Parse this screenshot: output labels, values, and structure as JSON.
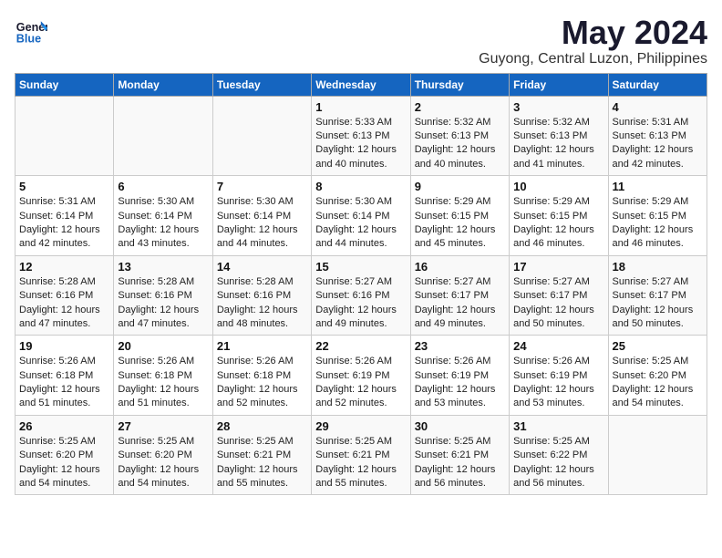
{
  "header": {
    "logo_line1": "General",
    "logo_line2": "Blue",
    "month": "May 2024",
    "location": "Guyong, Central Luzon, Philippines"
  },
  "weekdays": [
    "Sunday",
    "Monday",
    "Tuesday",
    "Wednesday",
    "Thursday",
    "Friday",
    "Saturday"
  ],
  "weeks": [
    [
      {
        "day": "",
        "info": ""
      },
      {
        "day": "",
        "info": ""
      },
      {
        "day": "",
        "info": ""
      },
      {
        "day": "1",
        "info": "Sunrise: 5:33 AM\nSunset: 6:13 PM\nDaylight: 12 hours\nand 40 minutes."
      },
      {
        "day": "2",
        "info": "Sunrise: 5:32 AM\nSunset: 6:13 PM\nDaylight: 12 hours\nand 40 minutes."
      },
      {
        "day": "3",
        "info": "Sunrise: 5:32 AM\nSunset: 6:13 PM\nDaylight: 12 hours\nand 41 minutes."
      },
      {
        "day": "4",
        "info": "Sunrise: 5:31 AM\nSunset: 6:13 PM\nDaylight: 12 hours\nand 42 minutes."
      }
    ],
    [
      {
        "day": "5",
        "info": "Sunrise: 5:31 AM\nSunset: 6:14 PM\nDaylight: 12 hours\nand 42 minutes."
      },
      {
        "day": "6",
        "info": "Sunrise: 5:30 AM\nSunset: 6:14 PM\nDaylight: 12 hours\nand 43 minutes."
      },
      {
        "day": "7",
        "info": "Sunrise: 5:30 AM\nSunset: 6:14 PM\nDaylight: 12 hours\nand 44 minutes."
      },
      {
        "day": "8",
        "info": "Sunrise: 5:30 AM\nSunset: 6:14 PM\nDaylight: 12 hours\nand 44 minutes."
      },
      {
        "day": "9",
        "info": "Sunrise: 5:29 AM\nSunset: 6:15 PM\nDaylight: 12 hours\nand 45 minutes."
      },
      {
        "day": "10",
        "info": "Sunrise: 5:29 AM\nSunset: 6:15 PM\nDaylight: 12 hours\nand 46 minutes."
      },
      {
        "day": "11",
        "info": "Sunrise: 5:29 AM\nSunset: 6:15 PM\nDaylight: 12 hours\nand 46 minutes."
      }
    ],
    [
      {
        "day": "12",
        "info": "Sunrise: 5:28 AM\nSunset: 6:16 PM\nDaylight: 12 hours\nand 47 minutes."
      },
      {
        "day": "13",
        "info": "Sunrise: 5:28 AM\nSunset: 6:16 PM\nDaylight: 12 hours\nand 47 minutes."
      },
      {
        "day": "14",
        "info": "Sunrise: 5:28 AM\nSunset: 6:16 PM\nDaylight: 12 hours\nand 48 minutes."
      },
      {
        "day": "15",
        "info": "Sunrise: 5:27 AM\nSunset: 6:16 PM\nDaylight: 12 hours\nand 49 minutes."
      },
      {
        "day": "16",
        "info": "Sunrise: 5:27 AM\nSunset: 6:17 PM\nDaylight: 12 hours\nand 49 minutes."
      },
      {
        "day": "17",
        "info": "Sunrise: 5:27 AM\nSunset: 6:17 PM\nDaylight: 12 hours\nand 50 minutes."
      },
      {
        "day": "18",
        "info": "Sunrise: 5:27 AM\nSunset: 6:17 PM\nDaylight: 12 hours\nand 50 minutes."
      }
    ],
    [
      {
        "day": "19",
        "info": "Sunrise: 5:26 AM\nSunset: 6:18 PM\nDaylight: 12 hours\nand 51 minutes."
      },
      {
        "day": "20",
        "info": "Sunrise: 5:26 AM\nSunset: 6:18 PM\nDaylight: 12 hours\nand 51 minutes."
      },
      {
        "day": "21",
        "info": "Sunrise: 5:26 AM\nSunset: 6:18 PM\nDaylight: 12 hours\nand 52 minutes."
      },
      {
        "day": "22",
        "info": "Sunrise: 5:26 AM\nSunset: 6:19 PM\nDaylight: 12 hours\nand 52 minutes."
      },
      {
        "day": "23",
        "info": "Sunrise: 5:26 AM\nSunset: 6:19 PM\nDaylight: 12 hours\nand 53 minutes."
      },
      {
        "day": "24",
        "info": "Sunrise: 5:26 AM\nSunset: 6:19 PM\nDaylight: 12 hours\nand 53 minutes."
      },
      {
        "day": "25",
        "info": "Sunrise: 5:25 AM\nSunset: 6:20 PM\nDaylight: 12 hours\nand 54 minutes."
      }
    ],
    [
      {
        "day": "26",
        "info": "Sunrise: 5:25 AM\nSunset: 6:20 PM\nDaylight: 12 hours\nand 54 minutes."
      },
      {
        "day": "27",
        "info": "Sunrise: 5:25 AM\nSunset: 6:20 PM\nDaylight: 12 hours\nand 54 minutes."
      },
      {
        "day": "28",
        "info": "Sunrise: 5:25 AM\nSunset: 6:21 PM\nDaylight: 12 hours\nand 55 minutes."
      },
      {
        "day": "29",
        "info": "Sunrise: 5:25 AM\nSunset: 6:21 PM\nDaylight: 12 hours\nand 55 minutes."
      },
      {
        "day": "30",
        "info": "Sunrise: 5:25 AM\nSunset: 6:21 PM\nDaylight: 12 hours\nand 56 minutes."
      },
      {
        "day": "31",
        "info": "Sunrise: 5:25 AM\nSunset: 6:22 PM\nDaylight: 12 hours\nand 56 minutes."
      },
      {
        "day": "",
        "info": ""
      }
    ]
  ]
}
